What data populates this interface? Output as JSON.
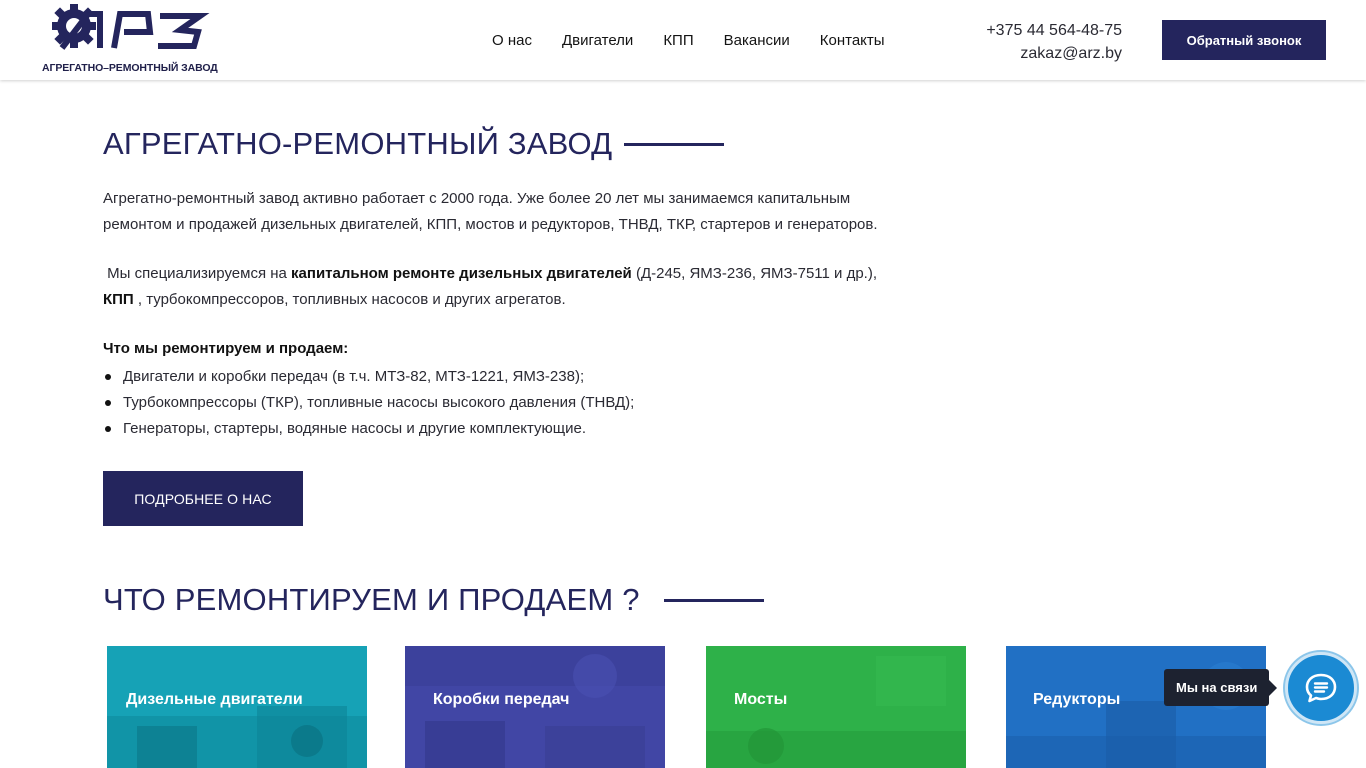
{
  "header": {
    "logo_text": "АРЗ",
    "logo_subtitle": "АГРЕГАТНО–РЕМОНТНЫЙ ЗАВОД",
    "nav": [
      {
        "label": "О нас"
      },
      {
        "label": "Двигатели"
      },
      {
        "label": "КПП"
      },
      {
        "label": "Вакансии"
      },
      {
        "label": "Контакты"
      }
    ],
    "phone": "+375 44 564-48-75",
    "email": "zakaz@arz.by",
    "callback_label": "Обратный звонок"
  },
  "about": {
    "title": "АГРЕГАТНО-РЕМОНТНЫЙ ЗАВОД",
    "paragraph1": "Агрегатно-ремонтный завод активно работает с 2000 года. Уже более 20 лет мы занимаемся капитальным ремонтом и продажей дизельных двигателей, КПП, мостов и редукторов, ТНВД, ТКР, стартеров и генераторов.",
    "p2_prefix": "Мы специализируемся на ",
    "p2_bold": "капитальном ремонте дизельных двигателей",
    "p2_middle": " (Д-245, ЯМЗ-236, ЯМЗ-7511 и др.),",
    "p2_bold2": "КПП",
    "p2_suffix": " , турбокомпрессоров, топливных насосов и других агрегатов.",
    "list_title": "Что мы ремонтируем и продаем:",
    "list": [
      "Двигатели и коробки передач (в т.ч. МТЗ-82, МТЗ-1221, ЯМЗ-238);",
      "Турбокомпрессоры (ТКР), топливные насосы высокого давления (ТНВД);",
      "Генераторы, стартеры, водяные насосы и другие комплектующие."
    ],
    "more_label": "ПОДРОБНЕЕ О НАС"
  },
  "products": {
    "title": "ЧТО РЕМОНТИРУЕМ И ПРОДАЕМ ?",
    "cards": [
      {
        "label": "Дизельные двигатели",
        "color": "#16a2b6"
      },
      {
        "label": "Коробки передач",
        "color": "#4146a5"
      },
      {
        "label": "Мосты",
        "color": "#2eb149"
      },
      {
        "label": "Редукторы",
        "color": "#2170c4"
      }
    ]
  },
  "chat": {
    "tooltip": "Мы на связи",
    "icon": "chat-bubble-icon"
  },
  "colors": {
    "brand": "#24255d",
    "chat": "#1b8ad3"
  }
}
